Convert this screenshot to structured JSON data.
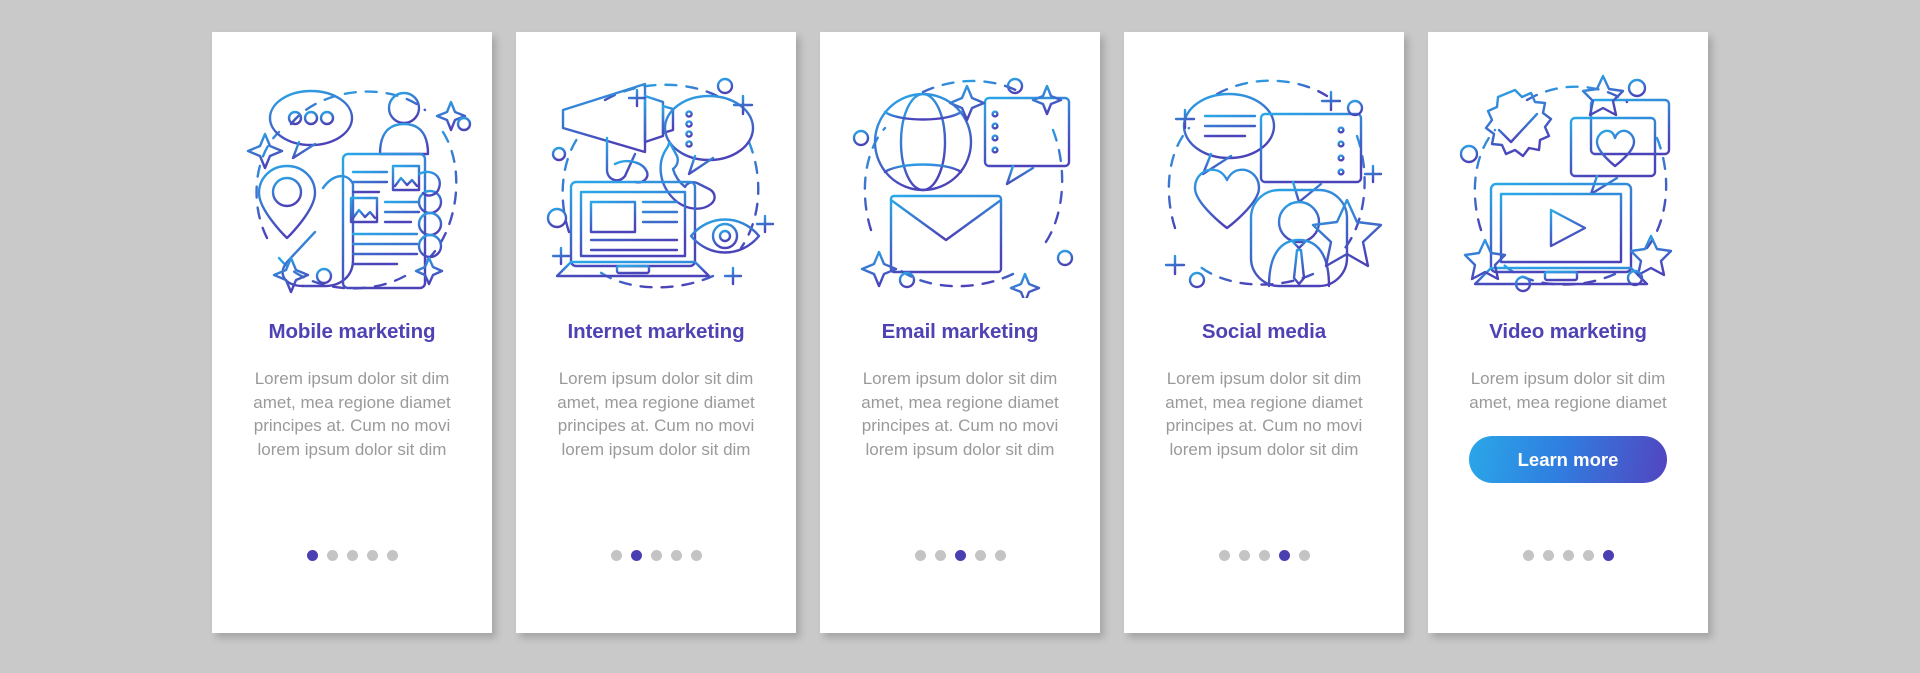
{
  "page": {
    "background_color": "#c9c9c9",
    "card_background": "#ffffff",
    "title_color": "#4f42b5",
    "body_color": "#9a9a9a",
    "dot_active_color": "#4a3fb0",
    "dot_inactive_color": "#c4c4c4",
    "illustration_gradient_start": "#29a8e8",
    "illustration_gradient_end": "#4b43b8",
    "cta_gradient_start": "#2aa7e8",
    "cta_gradient_end": "#5245c0"
  },
  "cards": [
    {
      "title": "Mobile marketing",
      "body": "Lorem ipsum dolor sit dim amet, mea regione diamet principes at. Cum no movi lorem ipsum dolor sit dim",
      "illustration": "mobile-marketing-illustration",
      "dots": {
        "total": 5,
        "active_index": 0
      },
      "cta": null
    },
    {
      "title": "Internet marketing",
      "body": "Lorem ipsum dolor sit dim amet, mea regione diamet principes at. Cum no movi lorem ipsum dolor sit dim",
      "illustration": "internet-marketing-illustration",
      "dots": {
        "total": 5,
        "active_index": 1
      },
      "cta": null
    },
    {
      "title": "Email marketing",
      "body": "Lorem ipsum dolor sit dim amet, mea regione diamet principes at. Cum no movi lorem ipsum dolor sit dim",
      "illustration": "email-marketing-illustration",
      "dots": {
        "total": 5,
        "active_index": 2
      },
      "cta": null
    },
    {
      "title": "Social media",
      "body": "Lorem ipsum dolor sit dim amet, mea regione diamet principes at. Cum no movi lorem ipsum dolor sit dim",
      "illustration": "social-media-illustration",
      "dots": {
        "total": 5,
        "active_index": 3
      },
      "cta": null
    },
    {
      "title": "Video marketing",
      "body": "Lorem ipsum dolor sit dim amet, mea regione diamet",
      "illustration": "video-marketing-illustration",
      "dots": {
        "total": 5,
        "active_index": 4
      },
      "cta": "Learn more"
    }
  ]
}
